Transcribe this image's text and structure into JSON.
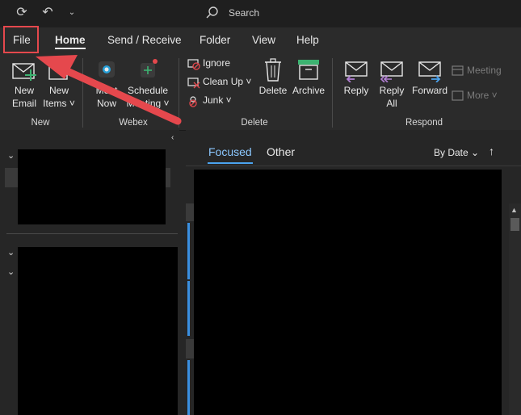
{
  "titlebar": {
    "icons": [
      "sync-icon",
      "undo-icon",
      "customize-toolbar-icon",
      "search-icon"
    ],
    "search_placeholder": "Search"
  },
  "menu": {
    "tabs": [
      "File",
      "Home",
      "Send / Receive",
      "Folder",
      "View",
      "Help"
    ],
    "active": "Home"
  },
  "ribbon": {
    "new_group": {
      "new_email": [
        "New",
        "Email"
      ],
      "new_items": [
        "New",
        "Items ˅"
      ],
      "label": "New"
    },
    "webex_group": {
      "meet_now": [
        "Meet",
        "Now"
      ],
      "schedule_meeting": [
        "Schedule",
        "Meeting ˅"
      ],
      "label": "Webex"
    },
    "delete_group": {
      "ignore": "Ignore",
      "clean_up": "Clean Up ˅",
      "junk": "Junk ˅",
      "delete": "Delete",
      "archive": "Archive",
      "label": "Delete"
    },
    "respond_group": {
      "reply": "Reply",
      "reply_all": [
        "Reply",
        "All"
      ],
      "forward": "Forward",
      "meeting": "Meeting",
      "more": "More ˅",
      "label": "Respond"
    }
  },
  "message_list": {
    "tabs": [
      "Focused",
      "Other"
    ],
    "active_tab": "Focused",
    "sort": "By Date",
    "sort_direction": "↑"
  },
  "colors": {
    "accent": "#4ba3ef",
    "annotation": "#e5484d"
  }
}
